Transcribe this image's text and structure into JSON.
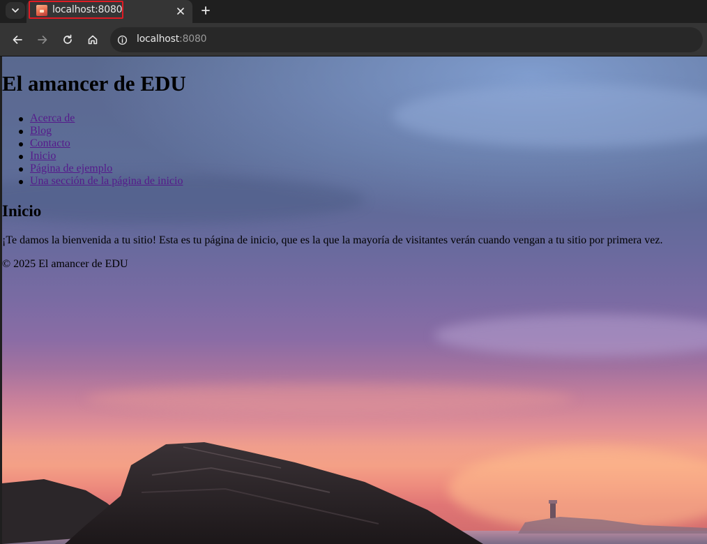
{
  "browser": {
    "tab": {
      "title": "localhost:8080"
    },
    "address_bar": {
      "host": "localhost",
      "port": ":8080"
    },
    "colors": {
      "chrome_dark": "#1f1f1f",
      "toolbar": "#353535",
      "tab_highlight": "#e01b24"
    }
  },
  "page": {
    "site_title": "El amancer de EDU",
    "nav": [
      {
        "label": "Acerca de"
      },
      {
        "label": "Blog"
      },
      {
        "label": "Contacto"
      },
      {
        "label": "Inicio"
      },
      {
        "label": "Página de ejemplo"
      },
      {
        "label": "Una sección de la página de inicio"
      }
    ],
    "section_heading": "Inicio",
    "welcome_text": "¡Te damos la bienvenida a tu sitio! Esta es tu página de inicio, que es la que la mayoría de visitantes verán cuando vengan a tu sitio por primera vez.",
    "footer": "© 2025 El amancer de EDU",
    "colors": {
      "link_visited": "#551a8b",
      "text": "#000000"
    }
  }
}
